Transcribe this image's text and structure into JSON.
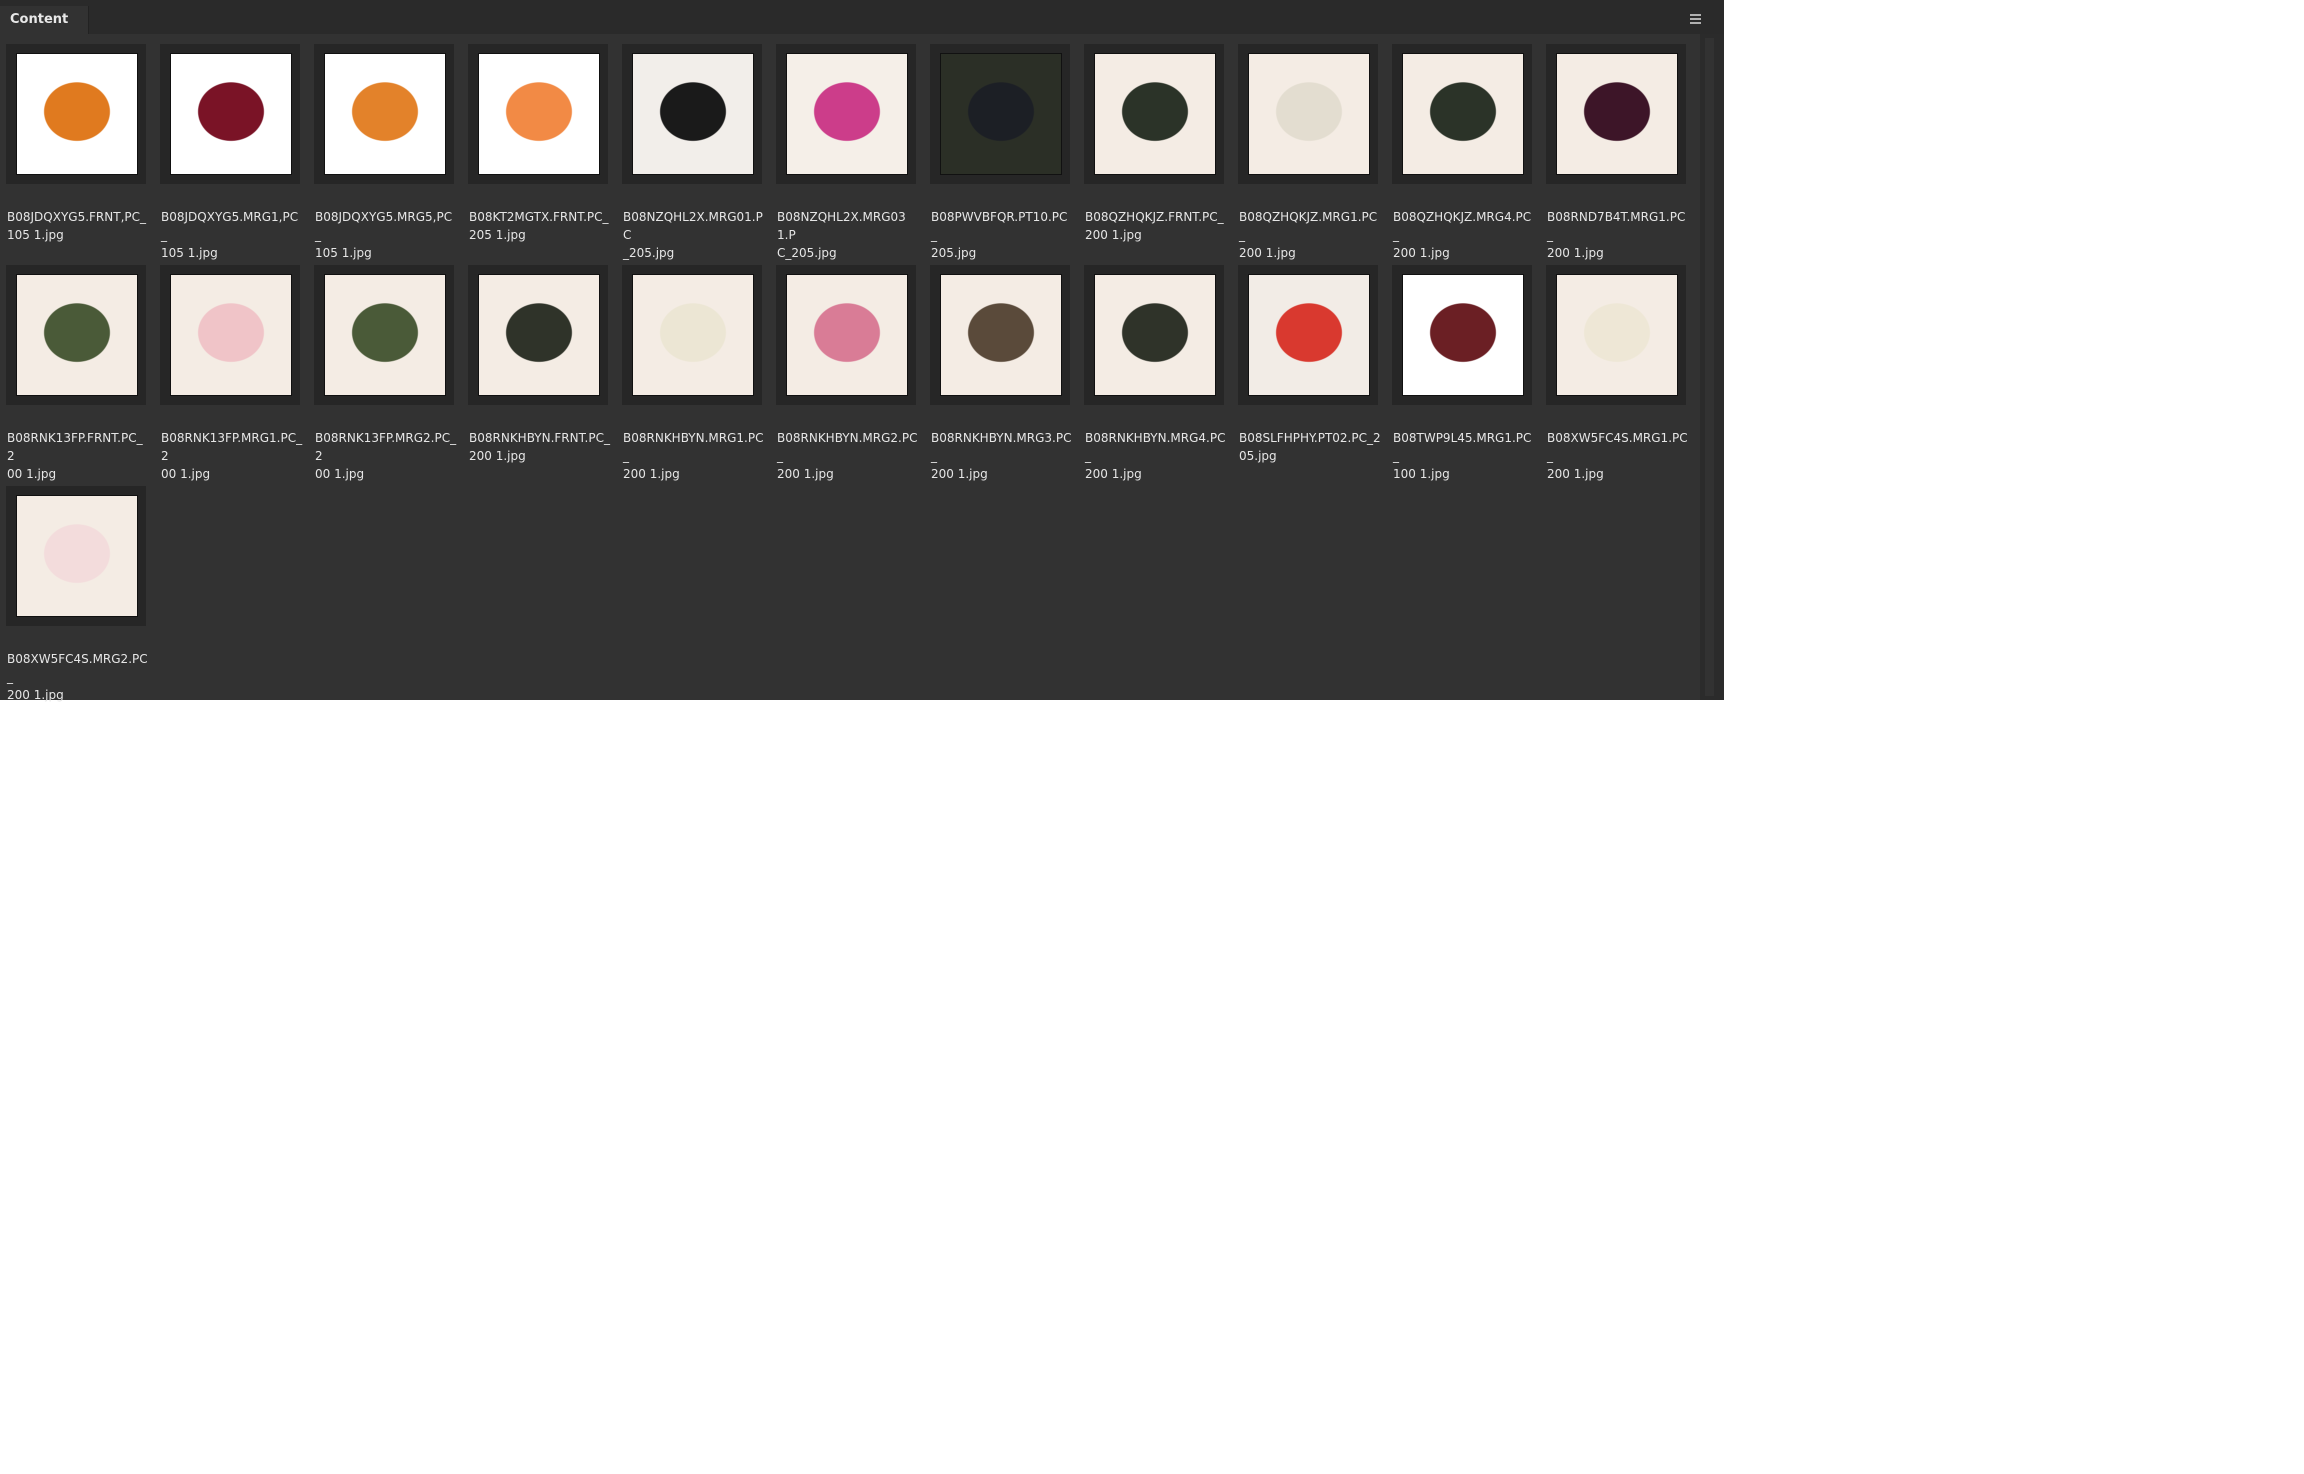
{
  "panel": {
    "tab_label": "Content",
    "menu_icon": "hamburger-menu-icon"
  },
  "items": [
    {
      "line1": "B08JDQXYG5.FRNT,PC_",
      "line2": "105 1.jpg",
      "swatch": "#e07a1f",
      "bg": "#ffffff"
    },
    {
      "line1": "B08JDQXYG5.MRG1,PC_",
      "line2": "105 1.jpg",
      "swatch": "#7a1326",
      "bg": "#ffffff"
    },
    {
      "line1": "B08JDQXYG5.MRG5,PC_",
      "line2": "105 1.jpg",
      "swatch": "#e3822a",
      "bg": "#ffffff"
    },
    {
      "line1": "B08KT2MGTX.FRNT.PC_",
      "line2": "205 1.jpg",
      "swatch": "#f28a45",
      "bg": "#ffffff"
    },
    {
      "line1": "B08NZQHL2X.MRG01.PC",
      "line2": "_205.jpg",
      "swatch": "#1a1a1a",
      "bg": "#f2eeea"
    },
    {
      "line1": "B08NZQHL2X.MRG03 1.P",
      "line2": "C_205.jpg",
      "swatch": "#cc3d8a",
      "bg": "#f5efe8"
    },
    {
      "line1": "B08PWVBFQR.PT10.PC_",
      "line2": "205.jpg",
      "swatch": "#1c1f25",
      "bg": "#2b2f26"
    },
    {
      "line1": "B08QZHQKJZ.FRNT.PC_",
      "line2": "200 1.jpg",
      "swatch": "#2b3328",
      "bg": "#f4ece4"
    },
    {
      "line1": "B08QZHQKJZ.MRG1.PC_",
      "line2": "200 1.jpg",
      "swatch": "#e3ddd0",
      "bg": "#f4ece4"
    },
    {
      "line1": "B08QZHQKJZ.MRG4.PC_",
      "line2": "200 1.jpg",
      "swatch": "#2b3328",
      "bg": "#f4ece4"
    },
    {
      "line1": "B08RND7B4T.MRG1.PC_",
      "line2": "200 1.jpg",
      "swatch": "#3d1528",
      "bg": "#f4ece4"
    },
    {
      "line1": "B08RNK13FP.FRNT.PC_2",
      "line2": "00 1.jpg",
      "swatch": "#4a5a38",
      "bg": "#f4ece4"
    },
    {
      "line1": "B08RNK13FP.MRG1.PC_2",
      "line2": "00 1.jpg",
      "swatch": "#f0c4c8",
      "bg": "#f4ece4"
    },
    {
      "line1": "B08RNK13FP.MRG2.PC_2",
      "line2": "00 1.jpg",
      "swatch": "#4a5a38",
      "bg": "#f4ece4"
    },
    {
      "line1": "B08RNKHBYN.FRNT.PC_",
      "line2": "200 1.jpg",
      "swatch": "#2f3329",
      "bg": "#f4ece4"
    },
    {
      "line1": "B08RNKHBYN.MRG1.PC_",
      "line2": "200 1.jpg",
      "swatch": "#ece6d4",
      "bg": "#f4ece4"
    },
    {
      "line1": "B08RNKHBYN.MRG2.PC_",
      "line2": "200 1.jpg",
      "swatch": "#d97c96",
      "bg": "#f4ece4"
    },
    {
      "line1": "B08RNKHBYN.MRG3.PC_",
      "line2": "200 1.jpg",
      "swatch": "#5a4a3a",
      "bg": "#f4ece4"
    },
    {
      "line1": "B08RNKHBYN.MRG4.PC_",
      "line2": "200 1.jpg",
      "swatch": "#2f3329",
      "bg": "#f4ece4"
    },
    {
      "line1": "B08SLFHPHY.PT02.PC_2",
      "line2": "05.jpg",
      "swatch": "#d9392f",
      "bg": "#f2ece6"
    },
    {
      "line1": "B08TWP9L45.MRG1.PC_",
      "line2": "100 1.jpg",
      "swatch": "#6b1f24",
      "bg": "#ffffff"
    },
    {
      "line1": "B08XW5FC4S.MRG1.PC_",
      "line2": "200 1.jpg",
      "swatch": "#eee7d6",
      "bg": "#f4ece4"
    },
    {
      "line1": "B08XW5FC4S.MRG2.PC_",
      "line2": "200 1.jpg",
      "swatch": "#f3dcdc",
      "bg": "#f4ece4"
    }
  ]
}
